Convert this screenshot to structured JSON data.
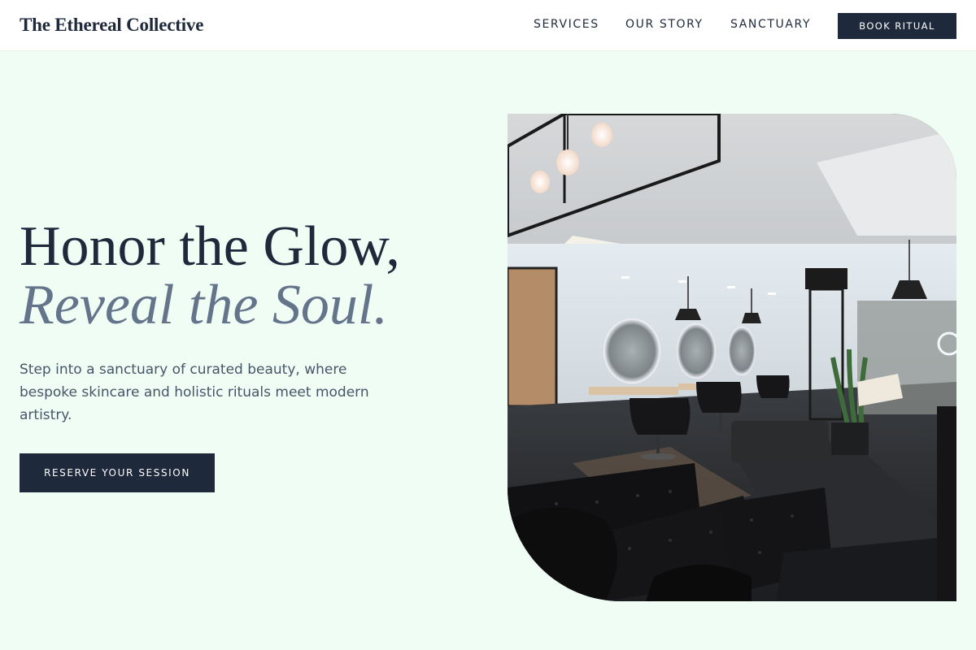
{
  "header": {
    "brand": "The Ethereal Collective",
    "nav": {
      "services": "SERVICES",
      "story": "OUR STORY",
      "sanctuary": "SANCTUARY"
    },
    "cta": "BOOK RITUAL"
  },
  "hero": {
    "title_line1": "Honor the Glow,",
    "title_line2": "Reveal the Soul.",
    "description": "Step into a sanctuary of curated beauty, where bespoke skincare and holistic rituals meet modern artistry.",
    "cta": "RESERVE YOUR SESSION",
    "image_alt": "salon-interior-photo"
  },
  "colors": {
    "background": "#f0fdf4",
    "primary": "#1e293b",
    "muted": "#64748b",
    "text": "#475569"
  }
}
